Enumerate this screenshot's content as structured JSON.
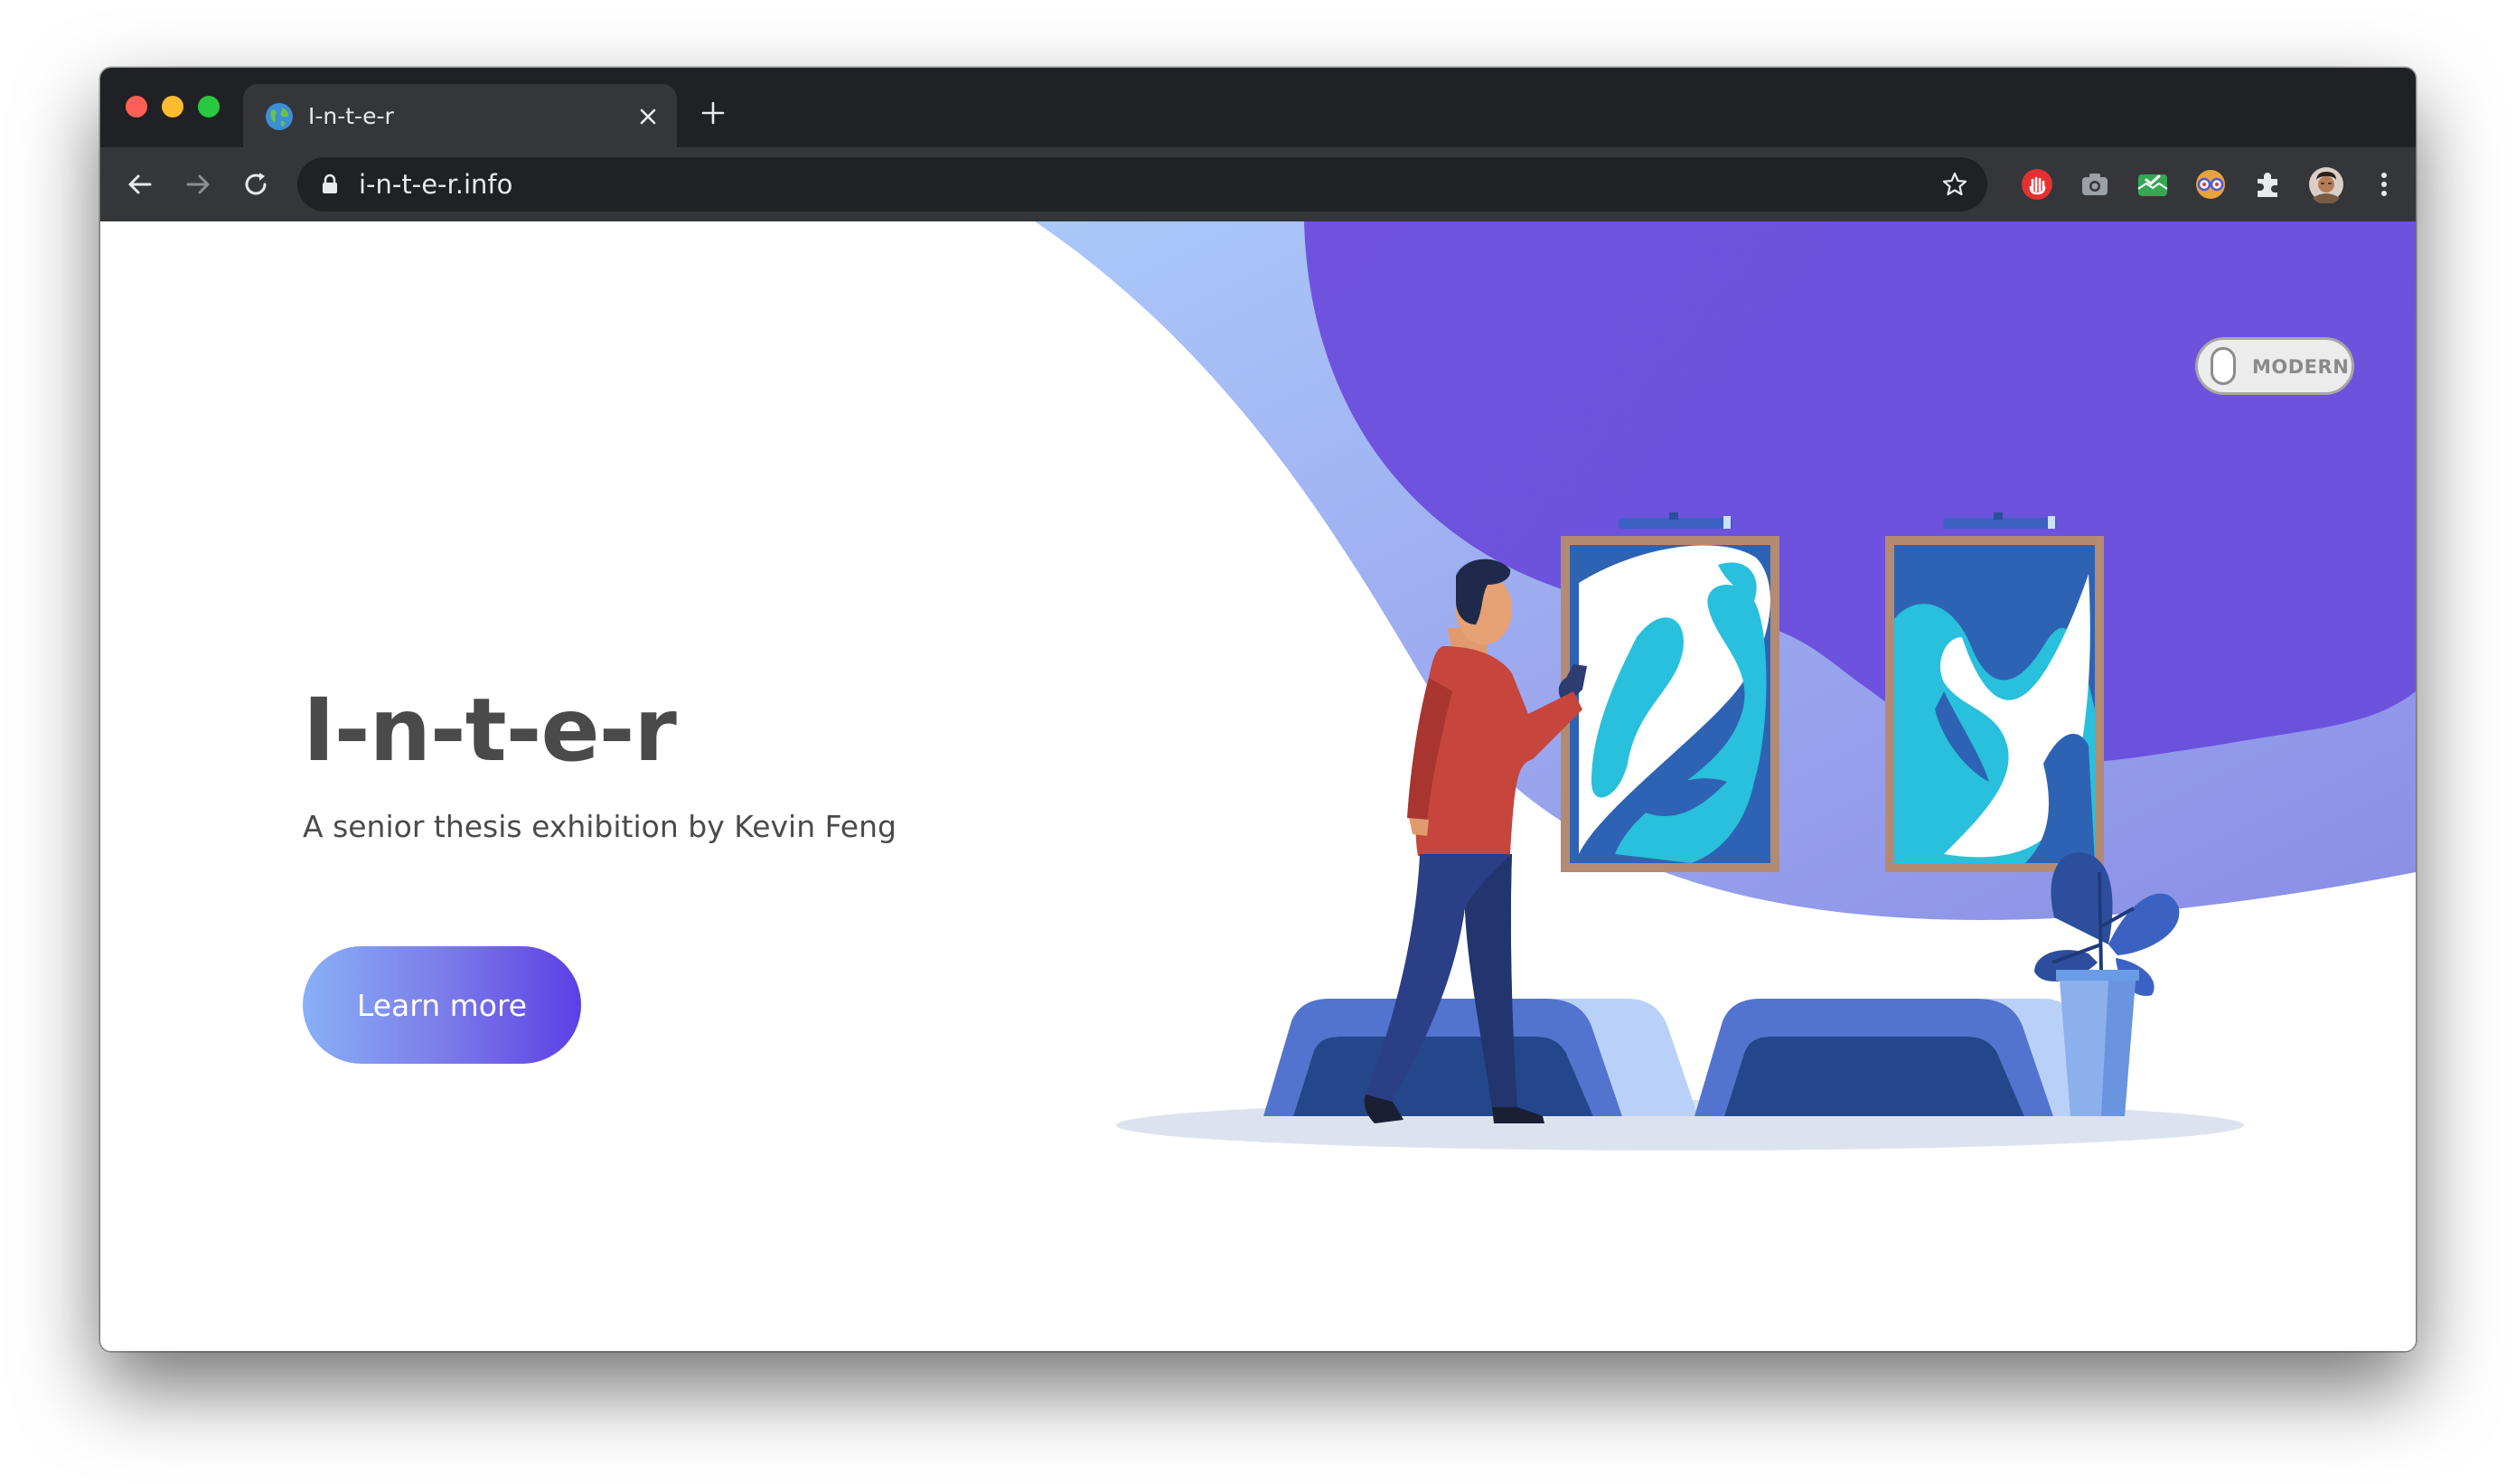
{
  "browser": {
    "tab": {
      "title": "I-n-t-e-r",
      "favicon": "globe-icon"
    },
    "address_bar": {
      "url": "i-n-t-e-r.info",
      "secure_icon": "lock-icon"
    },
    "navigation": {
      "back": "arrow-left-icon",
      "forward": "arrow-right-icon",
      "reload": "reload-icon"
    },
    "extensions": [
      "adblock-icon",
      "camera-icon",
      "mail-check-icon",
      "glasses-icon",
      "puzzle-icon",
      "profile-avatar",
      "kebab-menu-icon"
    ]
  },
  "page": {
    "title": "I-n-t-e-r",
    "subtitle": "A senior thesis exhibition by Kevin Feng",
    "cta_label": "Learn more",
    "mode_toggle_label": "MODERN"
  },
  "colors": {
    "accent_purple": "#6c53dd",
    "light_blue": "#a9c8f8",
    "title_text": "#4a4a4a",
    "chrome_dark": "#202124",
    "chrome_toolbar": "#35363a"
  }
}
